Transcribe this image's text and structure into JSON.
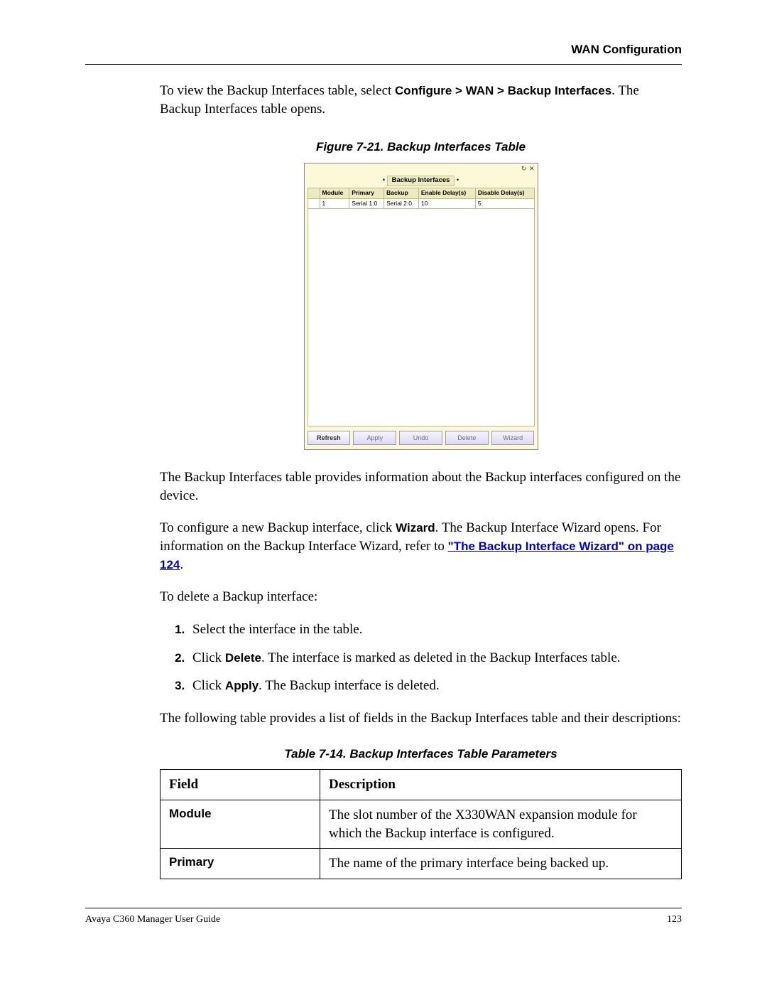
{
  "header": {
    "section": "WAN Configuration"
  },
  "intro": {
    "pre": "To view the Backup Interfaces table, select ",
    "path": "Configure > WAN > Backup Interfaces",
    "post": ". The Backup Interfaces table opens."
  },
  "figure": {
    "caption": "Figure 7-21.  Backup Interfaces Table",
    "panel_title": "Backup Interfaces",
    "icons": {
      "refresh": "↻",
      "close": "✕"
    },
    "columns": [
      "Module",
      "Primary",
      "Backup",
      "Enable Delay(s)",
      "Disable Delay(s)"
    ],
    "row": {
      "module": "1",
      "primary": "Serial 1:0",
      "backup": "Serial 2:0",
      "enable": "10",
      "disable": "5"
    },
    "buttons": [
      "Refresh",
      "Apply",
      "Undo",
      "Delete",
      "Wizard"
    ]
  },
  "p_after_fig": "The Backup Interfaces table provides information about the Backup interfaces configured on the device.",
  "p_wizard": {
    "pre": "To configure a new Backup interface, click ",
    "bold": "Wizard",
    "mid": ". The Backup Interface Wizard opens. For information on the Backup Interface Wizard, refer to ",
    "link": "\"The Backup Interface Wizard\" on page 124",
    "post": "."
  },
  "p_delete": "To delete a Backup interface:",
  "steps": {
    "s1": "Select the interface in the table.",
    "s2_pre": "Click ",
    "s2_bold": "Delete",
    "s2_post": ". The interface is marked as deleted in the Backup Interfaces table.",
    "s3_pre": "Click ",
    "s3_bold": "Apply",
    "s3_post": ". The Backup interface is deleted."
  },
  "p_table_intro": "The following table provides a list of fields in the Backup Interfaces table and their descriptions:",
  "table": {
    "caption": "Table 7-14.  Backup Interfaces Table Parameters",
    "headers": {
      "field": "Field",
      "desc": "Description"
    },
    "rows": [
      {
        "field": "Module",
        "desc": "The slot number of the X330WAN expansion module for which the Backup interface is configured."
      },
      {
        "field": "Primary",
        "desc": "The name of the primary interface being backed up."
      }
    ]
  },
  "footer": {
    "left": "Avaya C360 Manager User Guide",
    "right": "123"
  }
}
